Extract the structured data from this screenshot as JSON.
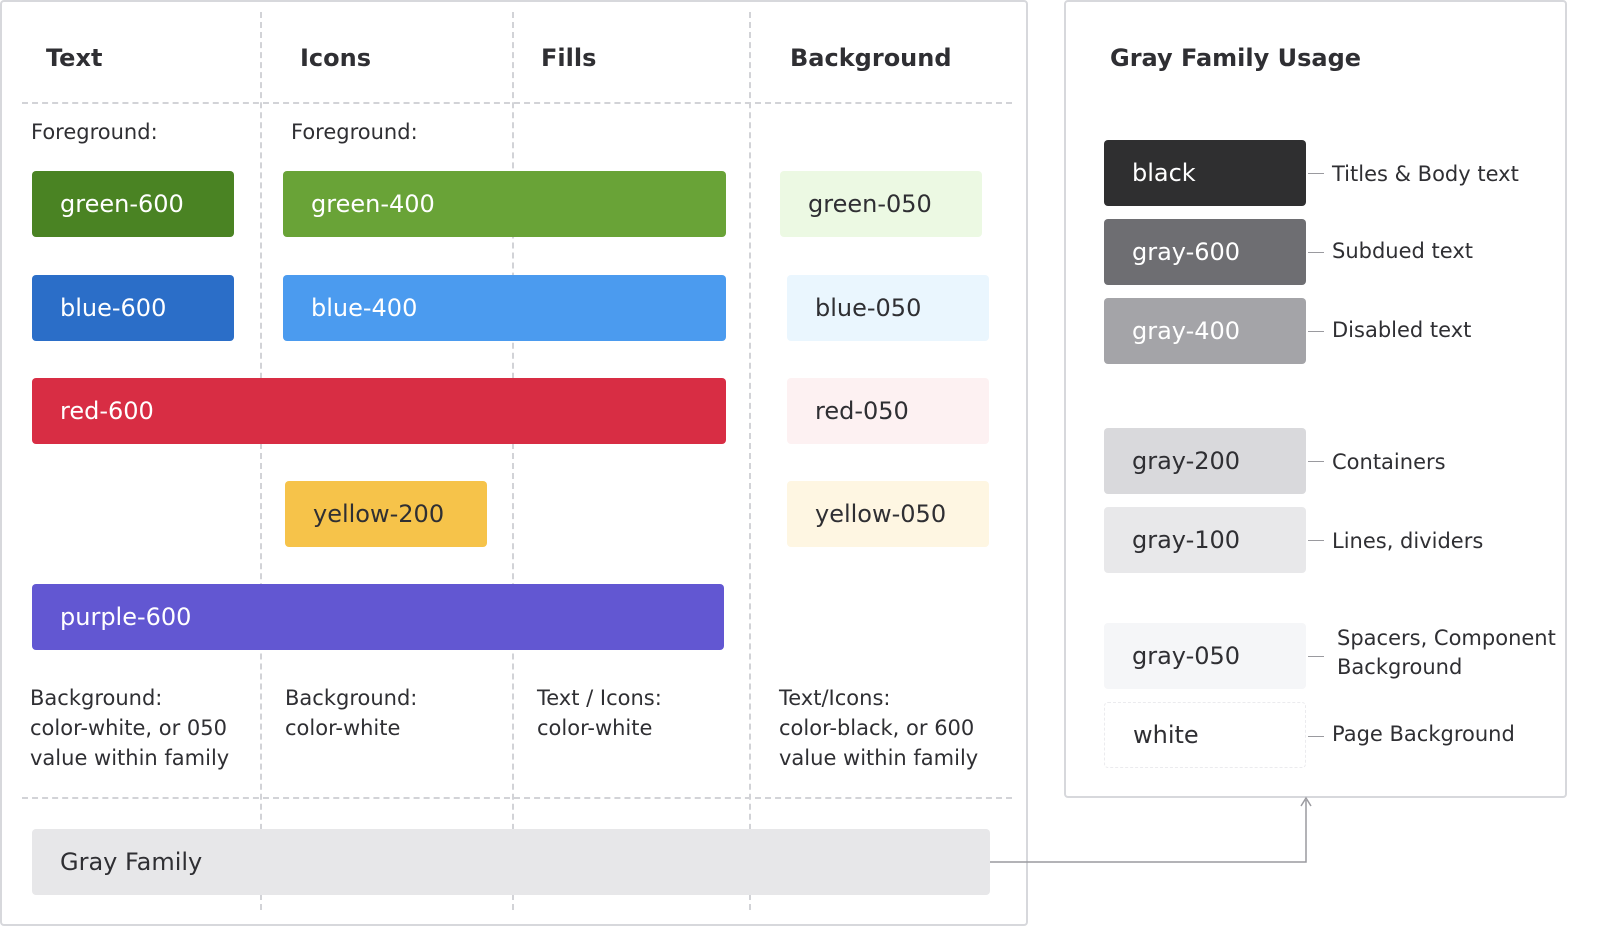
{
  "columns": {
    "text": "Text",
    "icons": "Icons",
    "fills": "Fills",
    "background": "Background"
  },
  "labels": {
    "text_foreground": "Foreground:",
    "icons_foreground": "Foreground:"
  },
  "swatches": {
    "green_600": "green-600",
    "green_400": "green-400",
    "green_050": "green-050",
    "blue_600": "blue-600",
    "blue_400": "blue-400",
    "blue_050": "blue-050",
    "red_600": "red-600",
    "red_050": "red-050",
    "yellow_200": "yellow-200",
    "yellow_050": "yellow-050",
    "purple_600": "purple-600",
    "gray_family": "Gray Family"
  },
  "notes": {
    "text_bg": "Background:\ncolor-white, or 050\nvalue within family",
    "icons_bg": "Background:\ncolor-white",
    "fills_text": "Text / Icons:\ncolor-white",
    "bg_text": "Text/Icons:\ncolor-black, or 600\nvalue within family"
  },
  "gray_panel": {
    "title": "Gray Family Usage",
    "items": [
      {
        "name": "black",
        "usage": "Titles & Body text"
      },
      {
        "name": "gray-600",
        "usage": "Subdued text"
      },
      {
        "name": "gray-400",
        "usage": "Disabled text"
      },
      {
        "name": "gray-200",
        "usage": "Containers"
      },
      {
        "name": "gray-100",
        "usage": "Lines, dividers"
      },
      {
        "name": "gray-050",
        "usage": "Spacers, Component\nBackground"
      },
      {
        "name": "white",
        "usage": "Page Background"
      }
    ]
  },
  "colors": {
    "green_600": "#4a8323",
    "green_400": "#69a337",
    "green_050": "#ecf9e3",
    "blue_600": "#2b6ec8",
    "blue_400": "#4b9bef",
    "blue_050": "#eaf6fe",
    "red_600": "#d82d44",
    "red_050": "#fdf1f2",
    "yellow_200": "#f6c34a",
    "yellow_050": "#fef6e2",
    "purple_600": "#6257d2",
    "black": "#2f2f30",
    "gray_600": "#6e6e72",
    "gray_400": "#a4a4a8",
    "gray_200": "#d9d9dc",
    "gray_100": "#e8e8ea",
    "gray_050": "#f5f6f8",
    "white": "#ffffff",
    "gray_family": "#e7e7e9"
  }
}
